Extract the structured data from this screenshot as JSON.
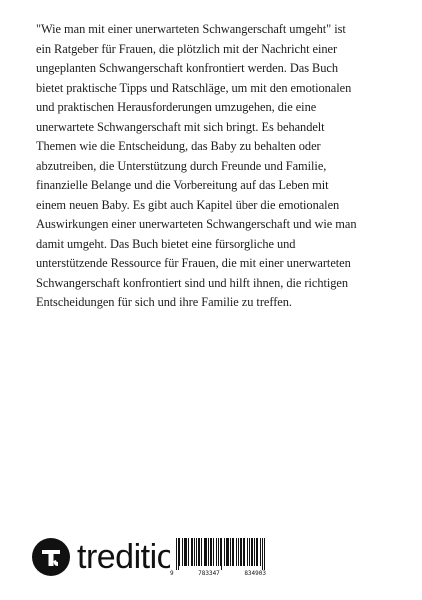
{
  "blurb": {
    "lines": [
      "\"Wie man mit einer unerwarteten Schwangerschaft umgeht\" ist",
      "ein Ratgeber für Frauen, die plötzlich mit der Nachricht einer",
      "ungeplanten Schwangerschaft konfrontiert werden. Das Buch",
      "bietet praktische Tipps und Ratschläge, um mit den emotionalen",
      "und praktischen Herausforderungen umzugehen, die eine",
      "unerwartete Schwangerschaft mit sich bringt. Es behandelt",
      "Themen wie die Entscheidung, das Baby zu behalten oder",
      "abzutreiben, die Unterstützung durch Freunde und Familie,",
      "finanzielle Belange und die Vorbereitung auf das Leben mit",
      "einem neuen Baby. Es gibt auch Kapitel über die emotionalen",
      "Auswirkungen einer unerwarteten Schwangerschaft und wie man",
      "damit umgeht. Das Buch bietet eine fürsorgliche und",
      "unterstützende Ressource für Frauen, die mit einer unerwarteten",
      "Schwangerschaft konfrontiert sind und hilft ihnen, die richtigen",
      "Entscheidungen für sich und ihre Familie zu treffen."
    ]
  },
  "publisher": {
    "logo_icon": "tredition-logo-icon",
    "name": "tredition"
  },
  "barcode": {
    "digits": [
      "9",
      "783347",
      "834903"
    ]
  },
  "colors": {
    "text": "#1c1c1c",
    "background": "#ffffff",
    "logo": "#111111"
  }
}
